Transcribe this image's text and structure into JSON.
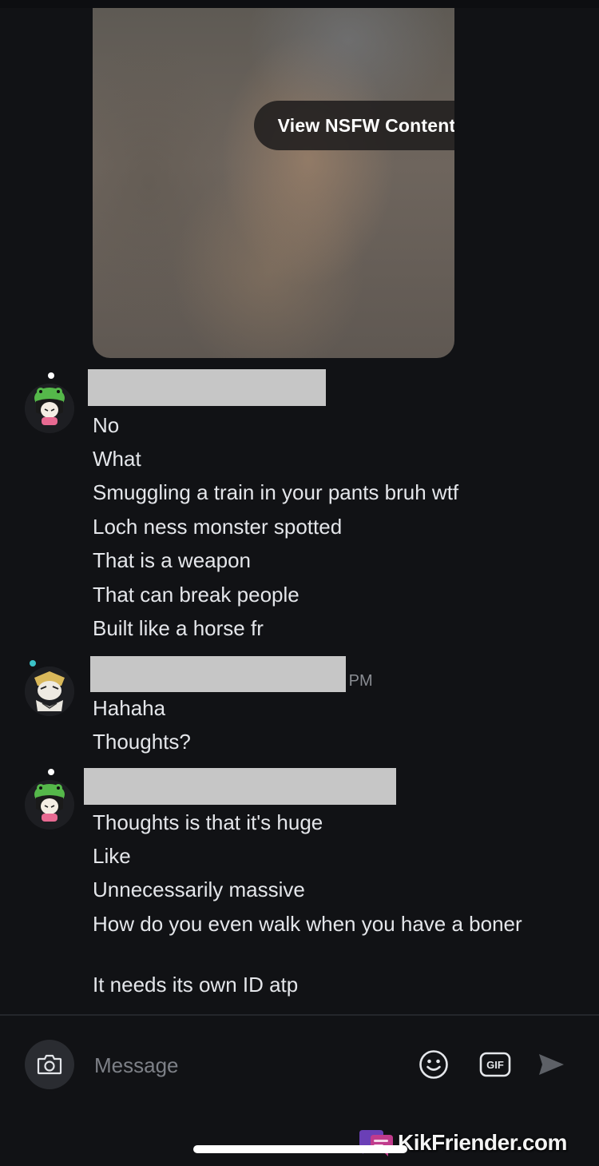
{
  "media": {
    "nsfw_button_label": "View NSFW Content"
  },
  "groups": [
    {
      "avatar_icon": "frog-girl-avatar-icon",
      "messages": [
        "No",
        "What",
        "Smuggling a train in your pants bruh wtf",
        "Loch ness monster spotted",
        "That is a weapon",
        "That can break people",
        "Built like a horse fr"
      ]
    },
    {
      "avatar_icon": "masked-warrior-avatar-icon",
      "timestamp": "3 PM",
      "messages": [
        "Hahaha",
        "Thoughts?"
      ]
    },
    {
      "avatar_icon": "frog-girl-avatar-icon",
      "messages": [
        "Thoughts is that it's huge",
        "Like",
        "Unnecessarily massive",
        "How do you even walk when you have a boner",
        "It needs its own ID atp"
      ]
    }
  ],
  "composer": {
    "placeholder": "Message",
    "camera_icon": "camera-icon",
    "emoji_icon": "smiley-icon",
    "gif_label": "GIF",
    "send_icon": "send-arrow-icon"
  },
  "watermark": {
    "text": "KikFriender.com"
  },
  "colors": {
    "background": "#111215",
    "text": "#e4e6ea",
    "redaction": "#c6c6c6",
    "accent_green": "#55b84a"
  }
}
